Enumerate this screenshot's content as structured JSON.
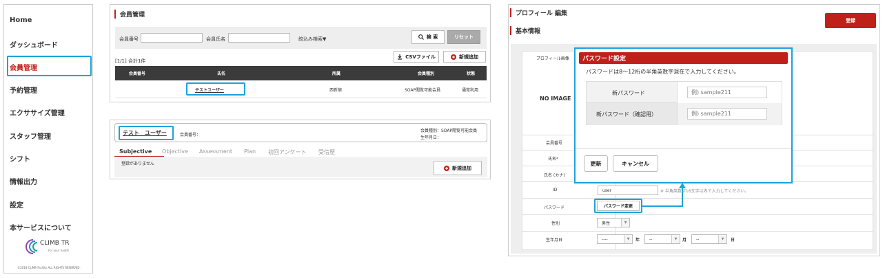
{
  "sidebar": {
    "items": [
      {
        "label": "Home"
      },
      {
        "label": "ダッシュボード"
      },
      {
        "label": "会員管理"
      },
      {
        "label": "予約管理"
      },
      {
        "label": "エクササイズ管理"
      },
      {
        "label": "スタッフ管理"
      },
      {
        "label": "シフト"
      },
      {
        "label": "情報出力"
      },
      {
        "label": "設定"
      },
      {
        "label": "本サービスについて"
      }
    ],
    "logo_text": "CLIMB TR",
    "logo_sub": "For your health",
    "copyright": "©2018 CLIMB Facility ALL RIGHTS RESERVED."
  },
  "member_list": {
    "title": "会員管理",
    "search": {
      "member_no_label": "会員番号",
      "member_name_label": "会員氏名",
      "filter_label": "絞込み検索▼",
      "search_button": "検 索",
      "reset_button": "リセット"
    },
    "summary": "[1/1] 合計1件",
    "csv_button": "CSVファイル",
    "new_button": "新規追加",
    "columns": [
      "会員番号",
      "氏名",
      "所属",
      "会員種別",
      "状態"
    ],
    "rows": [
      {
        "no": "",
        "name": "テストユーザー",
        "affiliation": "西新宿",
        "type": "SOAP閲覧可能会員",
        "status": "通常利用"
      }
    ]
  },
  "member_detail": {
    "name": "テスト　ユーザー",
    "member_no_label": "会員番号：",
    "type_line": "会員種別：SOAP閲覧可能会員",
    "birth_line": "生年月日：",
    "tabs": [
      "Subjective",
      "Objective",
      "Assessment",
      "Plan",
      "初回アンケート",
      "受信歴"
    ],
    "empty_text": "登録がありません",
    "new_button": "新規追加"
  },
  "profile_edit": {
    "title": "プロフィール 編集",
    "register_button": "登録",
    "section_title": "基本情報",
    "profile_image_label": "プロフィール画像",
    "no_image": "NO IMAGE",
    "fields": {
      "member_no": "会員番号",
      "name": "氏名",
      "required_mark": "*",
      "name_kana": "氏名 (カナ)",
      "id": "ID",
      "id_value": "user",
      "id_hint": "※ 半角英数字16文字以内で入力してください。",
      "password": "パスワード",
      "password_button": "パスワード変更",
      "gender": "性別",
      "gender_value": "男性",
      "birthdate": "生年月日",
      "year_value": "----",
      "year_unit": "年",
      "month_value": "--",
      "month_unit": "月",
      "day_value": "--",
      "day_unit": "日"
    }
  },
  "password_modal": {
    "title": "パスワード設定",
    "instruction": "パスワードは8～12桁の半角英数字混在で入力してください。",
    "new_password_label": "新パスワード",
    "new_password_placeholder": "例) sample211",
    "confirm_label": "新パスワード（確認用）",
    "confirm_placeholder": "例) sample211",
    "update_button": "更新",
    "cancel_button": "キャンセル"
  },
  "colors": {
    "accent_red": "#c0201a",
    "highlight_blue": "#1aa3dc",
    "table_header": "#3b3b3b"
  }
}
